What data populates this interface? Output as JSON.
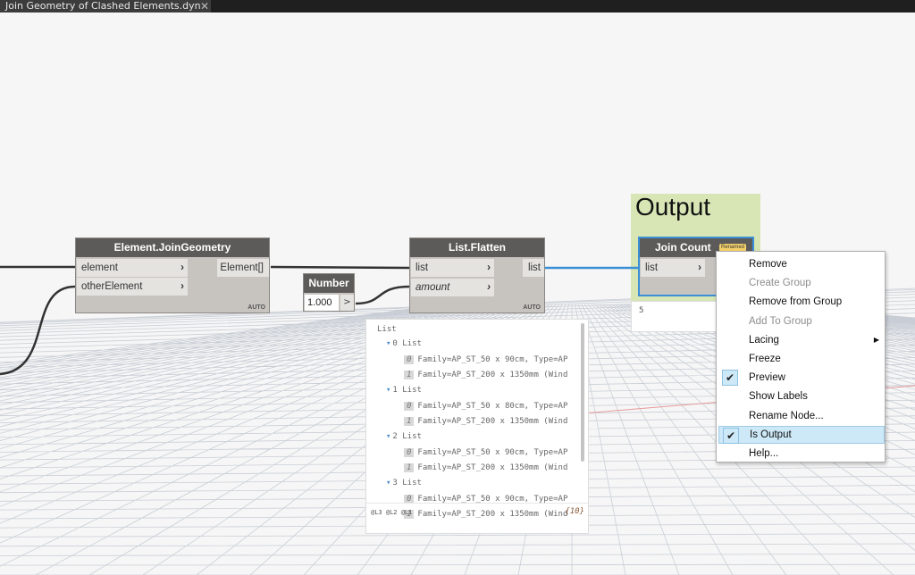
{
  "tab": {
    "title": "Join Geometry of Clashed Elements.dyn",
    "close": "✕"
  },
  "nodes": {
    "join_geometry": {
      "title": "Element.JoinGeometry",
      "inputs": [
        "element",
        "otherElement"
      ],
      "output": "Element[]",
      "lacing": "AUTO"
    },
    "number": {
      "title": "Number",
      "value": "1.000",
      "button": ">"
    },
    "flatten": {
      "title": "List.Flatten",
      "inputs": [
        "list",
        "amount"
      ],
      "output": "list",
      "lacing": "AUTO"
    },
    "join_count": {
      "title": "Join Count",
      "badge": "Renamed",
      "input": "list",
      "preview_value": "5"
    }
  },
  "group": {
    "title": "Output",
    "color": "#d8e6b5"
  },
  "preview": {
    "header": "List",
    "items": [
      {
        "kind": "sub",
        "label": "0 List"
      },
      {
        "kind": "item",
        "idx": "0",
        "text": "Family=AP_ST_50 x 90cm, Type=AP"
      },
      {
        "kind": "item",
        "idx": "1",
        "text": "Family=AP_ST_200 x 1350mm (Wind"
      },
      {
        "kind": "sub",
        "label": "1 List"
      },
      {
        "kind": "item",
        "idx": "0",
        "text": "Family=AP_ST_50 x 80cm, Type=AP"
      },
      {
        "kind": "item",
        "idx": "1",
        "text": "Family=AP_ST_200 x 1350mm (Wind"
      },
      {
        "kind": "sub",
        "label": "2 List"
      },
      {
        "kind": "item",
        "idx": "0",
        "text": "Family=AP_ST_50 x 90cm, Type=AP"
      },
      {
        "kind": "item",
        "idx": "1",
        "text": "Family=AP_ST_200 x 1350mm (Wind"
      },
      {
        "kind": "sub",
        "label": "3 List"
      },
      {
        "kind": "item",
        "idx": "0",
        "text": "Family=AP_ST_50 x 90cm, Type=AP"
      },
      {
        "kind": "item",
        "idx": "1",
        "text": "Family=AP_ST_200 x 1350mm (Wind"
      }
    ],
    "levels": "@L3 @L2 @L1",
    "count": "{10}"
  },
  "context_menu": {
    "items": [
      {
        "label": "Remove",
        "enabled": true,
        "checked": false,
        "submenu": false,
        "highlight": false
      },
      {
        "label": "Create Group",
        "enabled": false,
        "checked": false,
        "submenu": false,
        "highlight": false
      },
      {
        "label": "Remove from Group",
        "enabled": true,
        "checked": false,
        "submenu": false,
        "highlight": false
      },
      {
        "label": "Add To Group",
        "enabled": false,
        "checked": false,
        "submenu": false,
        "highlight": false
      },
      {
        "label": "Lacing",
        "enabled": true,
        "checked": false,
        "submenu": true,
        "highlight": false
      },
      {
        "label": "Freeze",
        "enabled": true,
        "checked": false,
        "submenu": false,
        "highlight": false
      },
      {
        "label": "Preview",
        "enabled": true,
        "checked": true,
        "submenu": false,
        "highlight": false
      },
      {
        "label": "Show Labels",
        "enabled": true,
        "checked": false,
        "submenu": false,
        "highlight": false
      },
      {
        "label": "Rename Node...",
        "enabled": true,
        "checked": false,
        "submenu": false,
        "highlight": false
      },
      {
        "label": "Is Output",
        "enabled": true,
        "checked": true,
        "submenu": false,
        "highlight": true
      },
      {
        "label": "Help...",
        "enabled": true,
        "checked": false,
        "submenu": false,
        "highlight": false
      }
    ]
  },
  "colors": {
    "wire_active": "#3a8fd6",
    "wire": "#333333",
    "node_header": "#5d5b5a",
    "grid": "#c9ced6"
  }
}
